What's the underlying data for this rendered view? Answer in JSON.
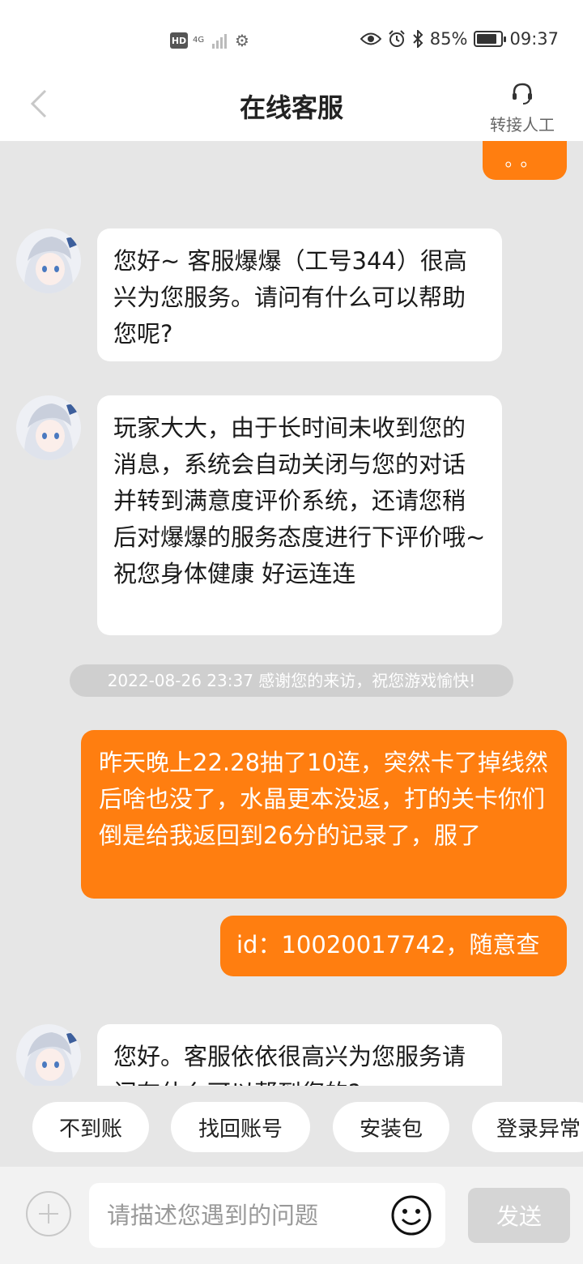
{
  "status_bar": {
    "hd_badge": "HD",
    "network": "4G",
    "battery_percent": "85%",
    "battery_level": 0.85,
    "time": "09:37",
    "icons": [
      "settings-icon",
      "eye-icon",
      "alarm-icon",
      "bluetooth-icon",
      "battery-icon"
    ]
  },
  "header": {
    "title": "在线客服",
    "transfer_label": "转接人工"
  },
  "chat": {
    "top_partial_dots": "。。",
    "messages": [
      {
        "sender": "agent",
        "text": "您好~ 客服爆爆（工号344）很高兴为您服务。请问有什么可以帮助您呢?"
      },
      {
        "sender": "agent",
        "text": "玩家大大，由于长时间未收到您的消息，系统会自动关闭与您的对话并转到满意度评价系统，还请您稍后对爆爆的服务态度进行下评价哦~祝您身体健康 好运连连"
      },
      {
        "sender": "system",
        "text": "2022-08-26 23:37 感谢您的来访，祝您游戏愉快!"
      },
      {
        "sender": "user",
        "text": "昨天晚上22.28抽了10连，突然卡了掉线然后啥也没了，水晶更本没返，打的关卡你们倒是给我返回到26分的记录了，服了"
      },
      {
        "sender": "user",
        "text": "id：10020017742，随意查"
      },
      {
        "sender": "agent",
        "text": "您好。客服依依很高兴为您服务请问有什么可以帮到您的?"
      }
    ]
  },
  "quick_replies": [
    "不到账",
    "找回账号",
    "安装包",
    "登录异常"
  ],
  "input": {
    "placeholder": "请描述您遇到的问题",
    "send_label": "发送"
  },
  "colors": {
    "accent": "#ff7e10",
    "chat_background": "#e6e6e6",
    "send_disabled": "#d5d5d5"
  }
}
